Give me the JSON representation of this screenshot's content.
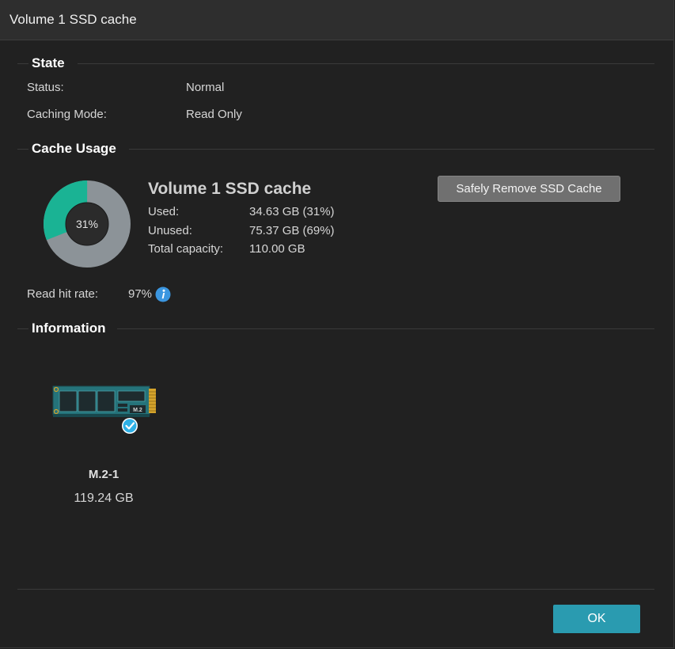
{
  "window": {
    "title": "Volume 1 SSD cache"
  },
  "state": {
    "heading": "State",
    "status_label": "Status:",
    "status_value": "Normal",
    "mode_label": "Caching Mode:",
    "mode_value": "Read Only"
  },
  "cache_usage": {
    "heading": "Cache Usage",
    "title": "Volume 1 SSD cache",
    "percent_label": "31%",
    "used_fraction": 0.31,
    "used_label": "Used:",
    "used_value": "34.63 GB (31%)",
    "unused_label": "Unused:",
    "unused_value": "75.37 GB (69%)",
    "total_label": "Total capacity:",
    "total_value": "110.00 GB",
    "remove_button": "Safely Remove SSD Cache",
    "read_hit_label": "Read hit rate:",
    "read_hit_value": "97%",
    "info_icon": "info-icon",
    "colors": {
      "used": "#1ab394",
      "unused": "#8c9398"
    }
  },
  "information": {
    "heading": "Information",
    "disks": [
      {
        "name": "M.2-1",
        "size": "119.24 GB",
        "icon": "ssd-m2-icon",
        "status_icon": "check-icon",
        "chip_label": "M.2"
      }
    ]
  },
  "footer": {
    "ok_button": "OK"
  }
}
